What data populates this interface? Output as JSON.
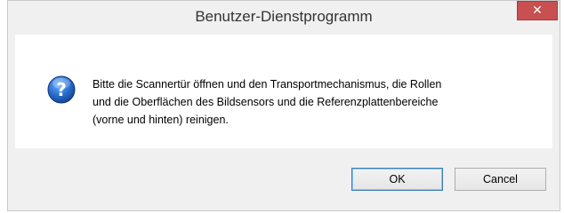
{
  "window": {
    "title": "Benutzer-Dienstprogramm",
    "close_glyph": "✕"
  },
  "message": {
    "text": "Bitte die Scannertür öffnen  und den Transportmechanismus, die Rollen\nund die Oberflächen des Bildsensors und die Referenzplattenbereiche\n(vorne und hinten) reinigen.",
    "icon": "question-icon"
  },
  "buttons": {
    "ok_label": "OK",
    "cancel_label": "Cancel"
  },
  "colors": {
    "close_button": "#c75050",
    "icon_blue": "#1e5fb3",
    "default_button_border": "#3c7fb1"
  }
}
